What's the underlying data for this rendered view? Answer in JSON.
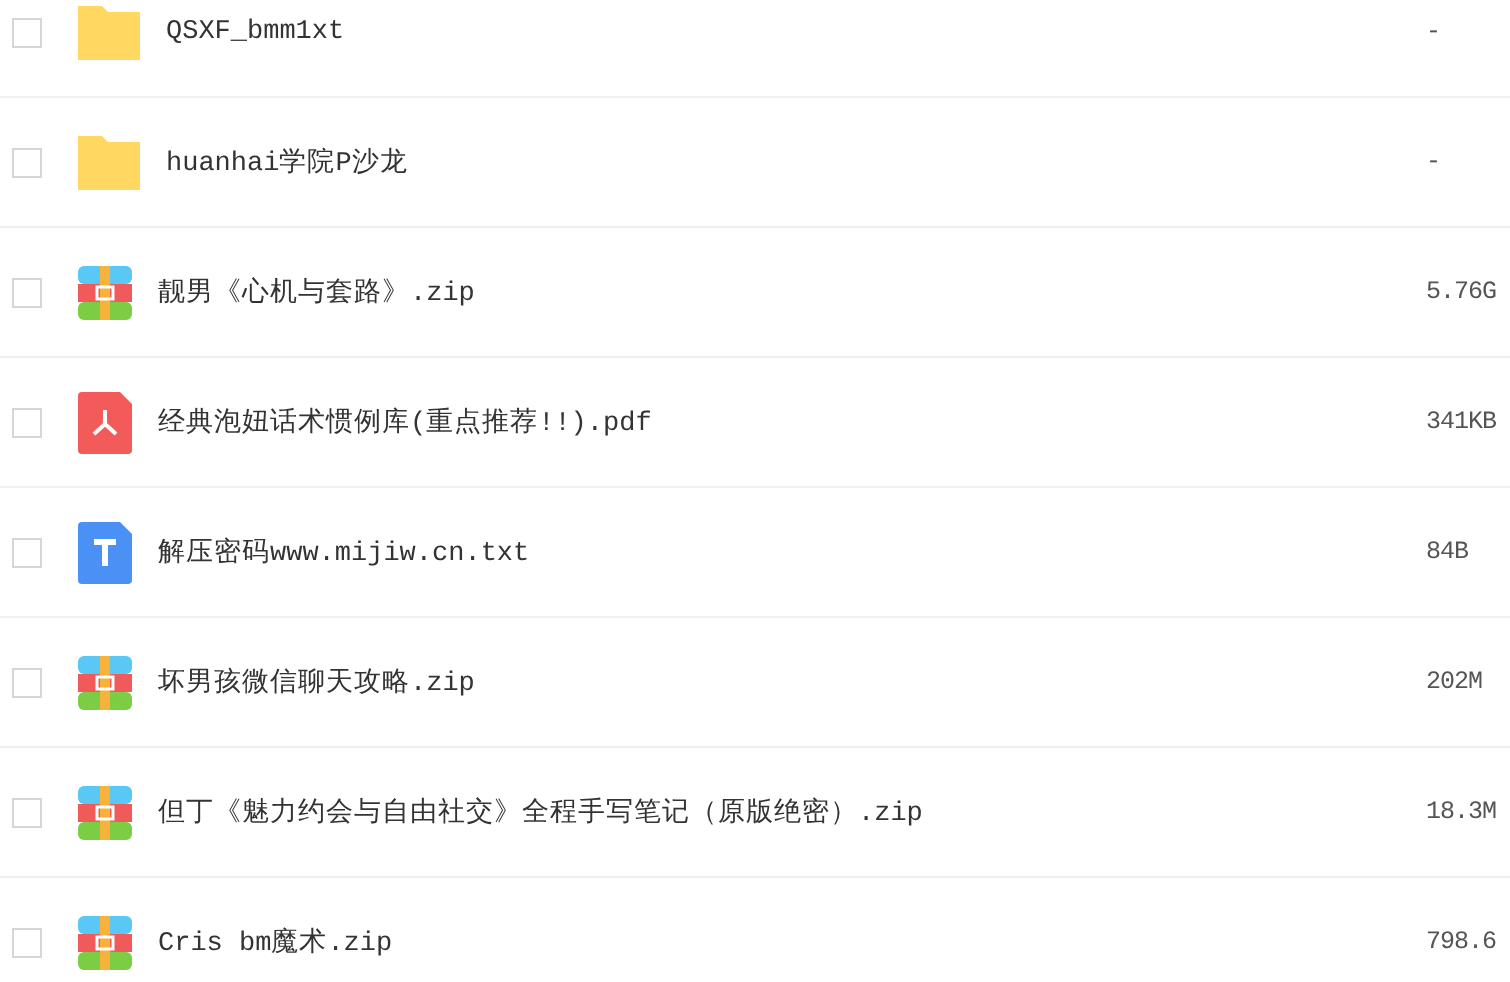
{
  "files": [
    {
      "kind": "folder",
      "name": "QSXF_bmm1xt",
      "size": "-",
      "checked": false
    },
    {
      "kind": "folder",
      "name": "huanhai学院P沙龙",
      "size": "-",
      "checked": false
    },
    {
      "kind": "zip",
      "name": "靓男《心机与套路》.zip",
      "size": "5.76G",
      "checked": false
    },
    {
      "kind": "pdf",
      "name": "经典泡妞话术惯例库(重点推荐!!).pdf",
      "size": "341KB",
      "checked": false
    },
    {
      "kind": "txt",
      "name": "解压密码www.mijiw.cn.txt",
      "size": "84B",
      "checked": false
    },
    {
      "kind": "zip",
      "name": "坏男孩微信聊天攻略.zip",
      "size": "202M",
      "checked": false
    },
    {
      "kind": "zip",
      "name": "但丁《魅力约会与自由社交》全程手写笔记（原版绝密）.zip",
      "size": "18.3M",
      "checked": false
    },
    {
      "kind": "zip",
      "name": "Cris bm魔术.zip",
      "size": "798.6",
      "checked": false
    }
  ]
}
